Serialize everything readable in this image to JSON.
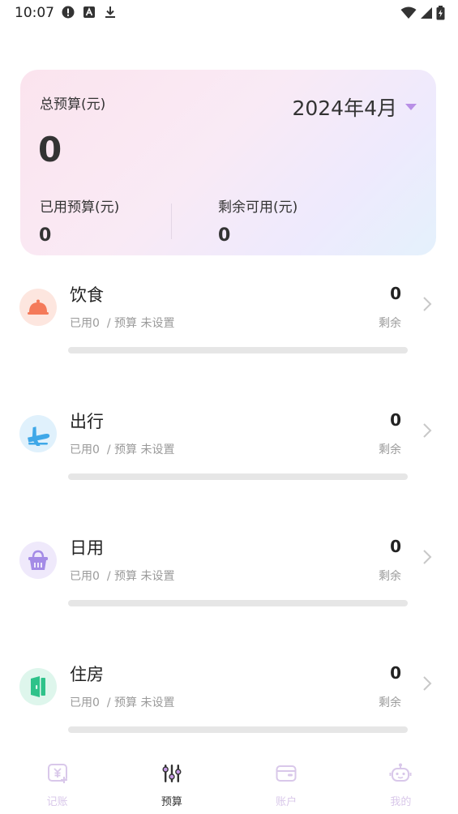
{
  "status_bar": {
    "time": "10:07"
  },
  "summary": {
    "total_label": "总预算(元)",
    "total_value": "0",
    "month": "2024年4月",
    "used_label": "已用预算(元)",
    "used_value": "0",
    "remaining_label": "剩余可用(元)",
    "remaining_value": "0"
  },
  "categories": [
    {
      "name": "饮食",
      "used": "已用0",
      "budget": "/ 预算 未设置",
      "remaining_value": "0",
      "remaining_label": "剩余",
      "icon": "food-cloche-icon",
      "icon_color": "#f47a5a",
      "icon_bg": "#fde6df",
      "progress": 0
    },
    {
      "name": "出行",
      "used": "已用0",
      "budget": "/ 预算 未设置",
      "remaining_value": "0",
      "remaining_label": "剩余",
      "icon": "plane-icon",
      "icon_color": "#3fa8e8",
      "icon_bg": "#e0f1fc",
      "progress": 0
    },
    {
      "name": "日用",
      "used": "已用0",
      "budget": "/ 预算 未设置",
      "remaining_value": "0",
      "remaining_label": "剩余",
      "icon": "basket-icon",
      "icon_color": "#a48be6",
      "icon_bg": "#efe9fb",
      "progress": 0
    },
    {
      "name": "住房",
      "used": "已用0",
      "budget": "/ 预算 未设置",
      "remaining_value": "0",
      "remaining_label": "剩余",
      "icon": "door-icon",
      "icon_color": "#2fc28a",
      "icon_bg": "#def6ec",
      "progress": 0
    }
  ],
  "bottom_nav": [
    {
      "label": "记账",
      "icon": "bookkeeping-icon",
      "active": false
    },
    {
      "label": "预算",
      "icon": "budget-sliders-icon",
      "active": true
    },
    {
      "label": "账户",
      "icon": "wallet-icon",
      "active": false
    },
    {
      "label": "我的",
      "icon": "robot-profile-icon",
      "active": false
    }
  ],
  "colors": {
    "accent": "#b88fe6",
    "inactive_nav": "#d9c8ea",
    "progress_track": "#e6e6e6"
  }
}
